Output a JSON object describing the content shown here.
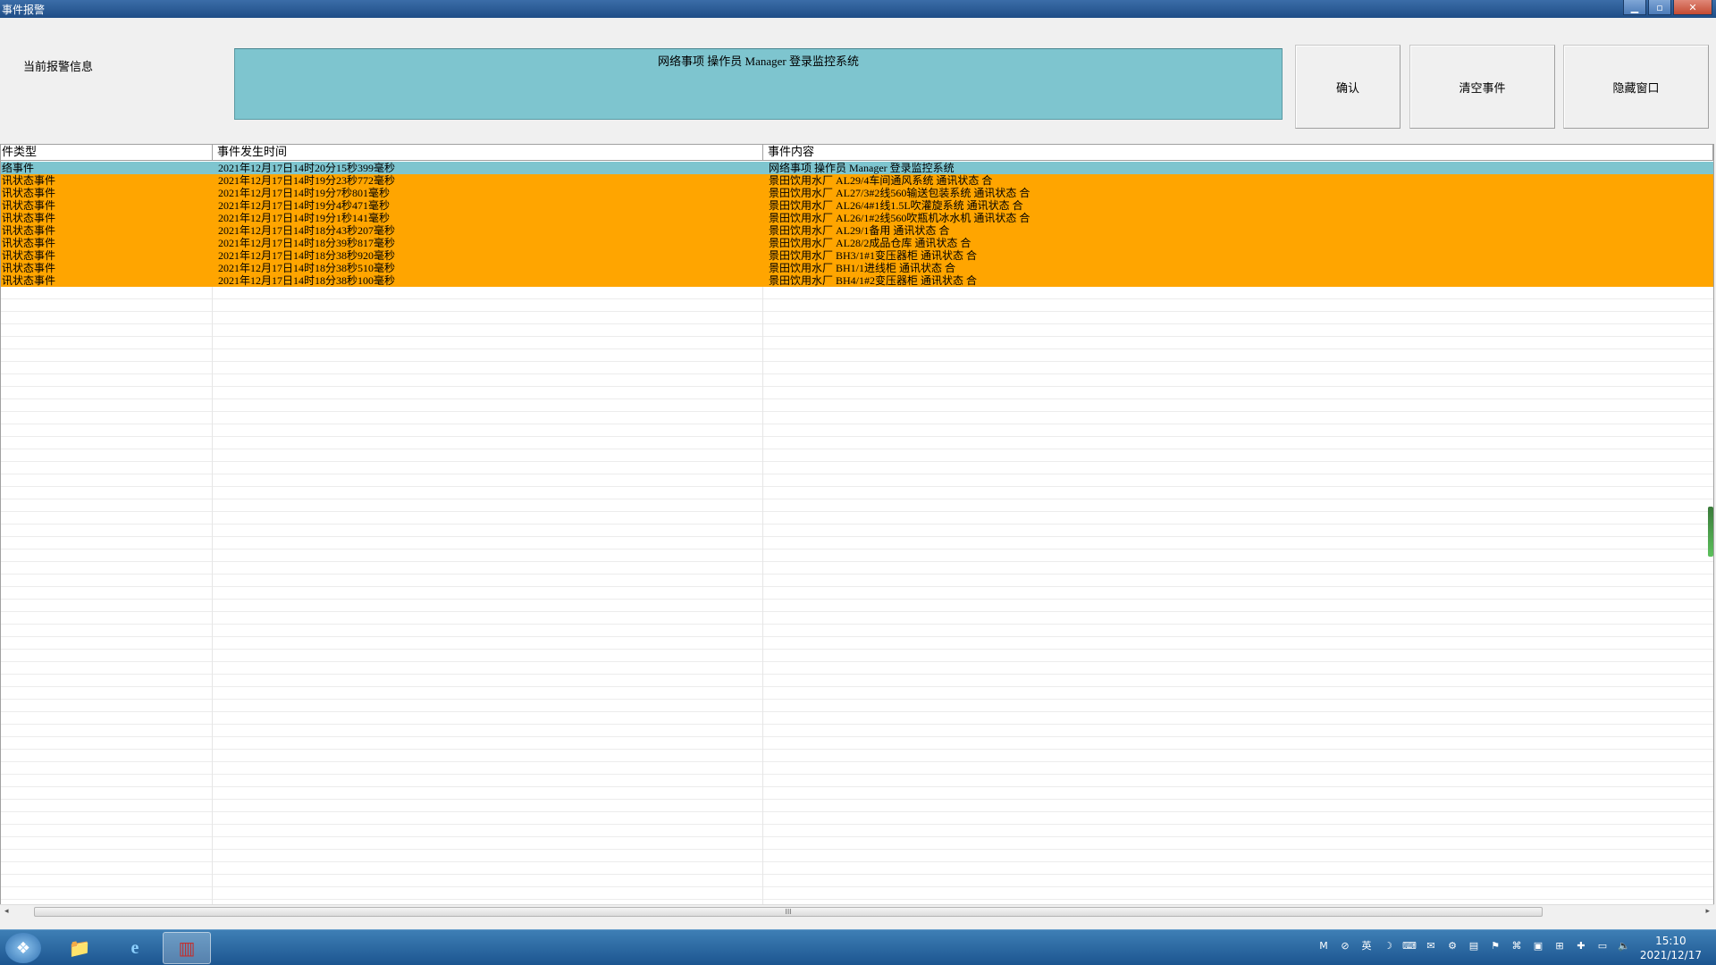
{
  "window": {
    "title": "事件报警",
    "minimize_icon": "minimize-icon",
    "maximize_icon": "maximize-icon",
    "close_icon": "close-icon"
  },
  "header": {
    "label": "当前报警信息",
    "message": "网络事项 操作员 Manager 登录监控系统",
    "buttons": {
      "confirm": "确认",
      "clear": "清空事件",
      "hide": "隐藏窗口"
    }
  },
  "table": {
    "columns": [
      "件类型",
      "事件发生时间",
      "事件内容"
    ],
    "rows": [
      {
        "type": "络事件",
        "time": "2021年12月17日14时20分15秒399毫秒",
        "content": "网络事项 操作员 Manager 登录监控系统",
        "style": "sel"
      },
      {
        "type": "讯状态事件",
        "time": "2021年12月17日14时19分23秒772毫秒",
        "content": "景田饮用水厂 AL29/4车间通风系统 通讯状态 合",
        "style": "warn"
      },
      {
        "type": "讯状态事件",
        "time": "2021年12月17日14时19分7秒801毫秒",
        "content": "景田饮用水厂 AL27/3#2线560输送包装系统 通讯状态 合",
        "style": "warn"
      },
      {
        "type": "讯状态事件",
        "time": "2021年12月17日14时19分4秒471毫秒",
        "content": "景田饮用水厂 AL26/4#1线1.5L吹灌旋系统 通讯状态 合",
        "style": "warn"
      },
      {
        "type": "讯状态事件",
        "time": "2021年12月17日14时19分1秒141毫秒",
        "content": "景田饮用水厂 AL26/1#2线560吹瓶机冰水机 通讯状态 合",
        "style": "warn"
      },
      {
        "type": "讯状态事件",
        "time": "2021年12月17日14时18分43秒207毫秒",
        "content": "景田饮用水厂 AL29/1备用 通讯状态 合",
        "style": "warn"
      },
      {
        "type": "讯状态事件",
        "time": "2021年12月17日14时18分39秒817毫秒",
        "content": "景田饮用水厂 AL28/2成品仓库 通讯状态 合",
        "style": "warn"
      },
      {
        "type": "讯状态事件",
        "time": "2021年12月17日14时18分38秒920毫秒",
        "content": "景田饮用水厂 BH3/1#1变压器柜 通讯状态 合",
        "style": "warn"
      },
      {
        "type": "讯状态事件",
        "time": "2021年12月17日14时18分38秒510毫秒",
        "content": "景田饮用水厂 BH1/1进线柜 通讯状态 合",
        "style": "warn"
      },
      {
        "type": "讯状态事件",
        "time": "2021年12月17日14时18分38秒100毫秒",
        "content": "景田饮用水厂 BH4/1#2变压器柜 通讯状态 合",
        "style": "warn"
      }
    ]
  },
  "scrollbar": {
    "thumb_grip": "III"
  },
  "colors": {
    "selected_row": "#7ec5cf",
    "warning_row": "#ffa500",
    "info_box": "#7ec5cf"
  },
  "taskbar": {
    "start_icon": "windows-start-icon",
    "apps": [
      "file-explorer-icon",
      "internet-explorer-icon",
      "event-alarm-app-icon"
    ],
    "tray": [
      "M",
      "⊘",
      "英",
      "☽",
      "⌨",
      "✉",
      "⚙",
      "▤",
      "⚑",
      "⌘",
      "▣",
      "⊞",
      "✚",
      "▭",
      "🔈"
    ],
    "clock": {
      "time": "15:10",
      "date": "2021/12/17"
    }
  }
}
